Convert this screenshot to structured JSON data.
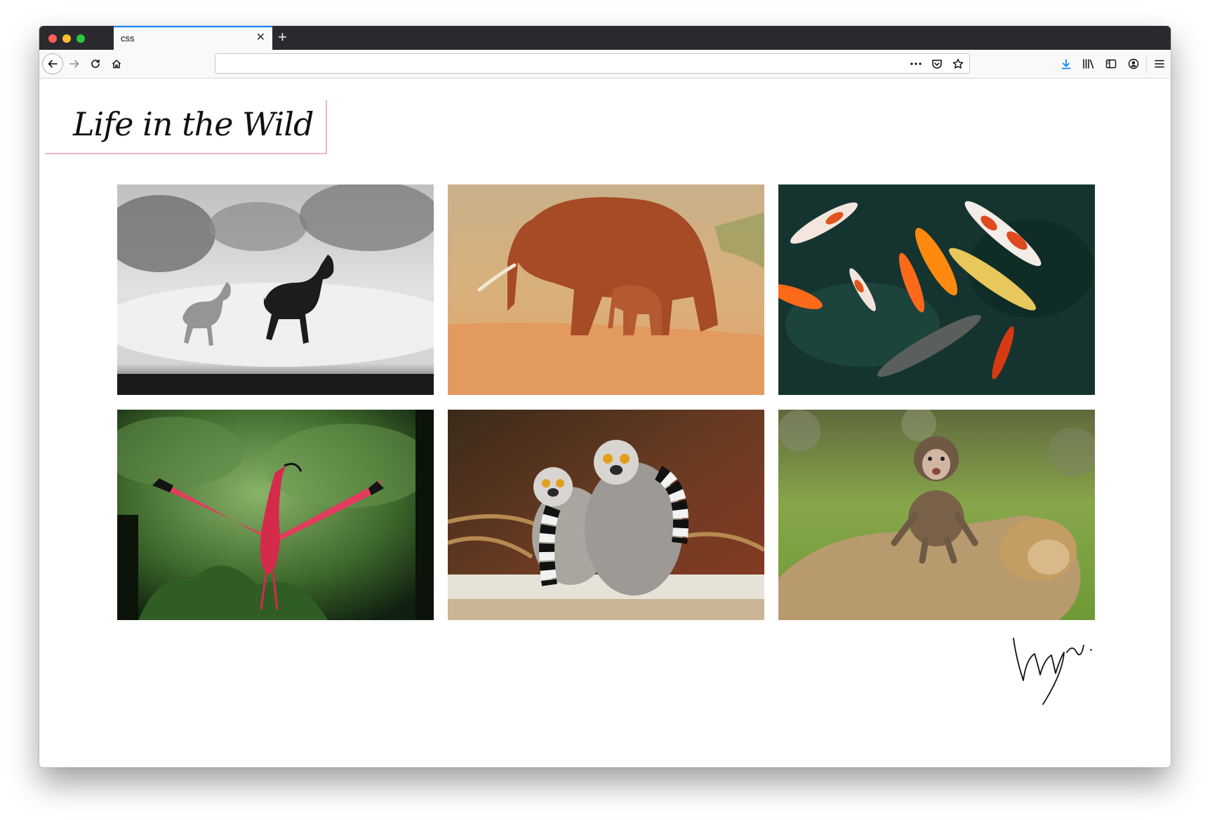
{
  "browser": {
    "tab": {
      "title": "css"
    },
    "icons": {
      "back": "back-arrow-icon",
      "forward": "forward-arrow-icon",
      "reload": "reload-icon",
      "home": "home-icon",
      "page_actions": "more-dots-icon",
      "pocket": "pocket-icon",
      "bookmark": "bookmark-star-icon",
      "downloads": "download-icon",
      "library": "library-icon",
      "sidebar": "sidebar-icon",
      "account": "account-icon",
      "menu": "hamburger-menu-icon"
    },
    "accent_color": "#0a84ff"
  },
  "page": {
    "title": "Life in the Wild",
    "title_border_color": "#f5b6c9",
    "gallery": [
      {
        "subject": "horses"
      },
      {
        "subject": "elephants"
      },
      {
        "subject": "koi-fish"
      },
      {
        "subject": "scarlet-ibis"
      },
      {
        "subject": "lemurs"
      },
      {
        "subject": "monkeys"
      }
    ]
  }
}
